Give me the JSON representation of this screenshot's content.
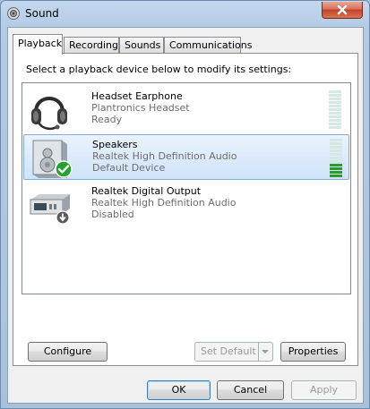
{
  "window": {
    "title": "Sound"
  },
  "tabs": [
    {
      "label": "Playback",
      "active": true
    },
    {
      "label": "Recording",
      "active": false
    },
    {
      "label": "Sounds",
      "active": false
    },
    {
      "label": "Communications",
      "active": false
    }
  ],
  "instruction": "Select a playback device below to modify its settings:",
  "devices": [
    {
      "name": "Headset Earphone",
      "description": "Plantronics Headset",
      "status": "Ready",
      "icon": "headset-icon",
      "selected": false,
      "meter_level": 0
    },
    {
      "name": "Speakers",
      "description": "Realtek High Definition Audio",
      "status": "Default Device",
      "icon": "speaker-icon",
      "badge": "check-badge-icon",
      "selected": true,
      "meter_level": 0.36
    },
    {
      "name": "Realtek Digital Output",
      "description": "Realtek High Definition Audio",
      "status": "Disabled",
      "icon": "digital-output-icon",
      "badge": "disabled-arrow-icon",
      "selected": false
    }
  ],
  "buttons": {
    "configure": "Configure",
    "set_default": "Set Default",
    "properties": "Properties",
    "ok": "OK",
    "cancel": "Cancel",
    "apply": "Apply"
  },
  "colors": {
    "selection": "#cfe3fa",
    "meter_on": "#2c9a2c",
    "meter_off": "#d4e8e4",
    "check": "#22a32a"
  }
}
